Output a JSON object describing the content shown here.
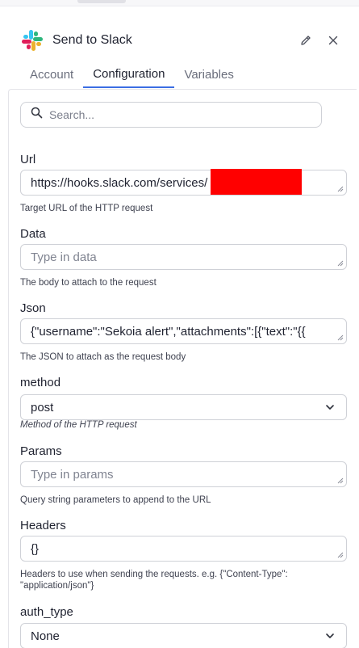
{
  "header": {
    "title": "Send to Slack",
    "logo_icon": "slack-logo-icon",
    "edit_icon": "pencil-icon",
    "close_icon": "close-icon"
  },
  "tabs": [
    {
      "label": "Account",
      "active": false
    },
    {
      "label": "Configuration",
      "active": true
    },
    {
      "label": "Variables",
      "active": false
    }
  ],
  "search": {
    "placeholder": "Search...",
    "icon": "search-icon"
  },
  "fields": {
    "url": {
      "label": "Url",
      "value": "https://hooks.slack.com/services/",
      "help": "Target URL of the HTTP request"
    },
    "data": {
      "label": "Data",
      "placeholder": "Type in data",
      "help": "The body to attach to the request"
    },
    "json": {
      "label": "Json",
      "value": "{\"username\":\"Sekoia alert\",\"attachments\":[{\"text\":\"{{",
      "help": "The JSON to attach as the request body"
    },
    "method": {
      "label": "method",
      "value": "post",
      "help": "Method of the HTTP request"
    },
    "params": {
      "label": "Params",
      "placeholder": "Type in params",
      "help": "Query string parameters to append to the URL"
    },
    "headers": {
      "label": "Headers",
      "value": "{}",
      "help": "Headers to use when sending the requests. e.g. {\"Content-Type\": \"application/json\"}"
    },
    "auth_type": {
      "label": "auth_type",
      "value": "None"
    }
  },
  "colors": {
    "accent": "#3b6ee3",
    "redaction": "#ff0000"
  }
}
